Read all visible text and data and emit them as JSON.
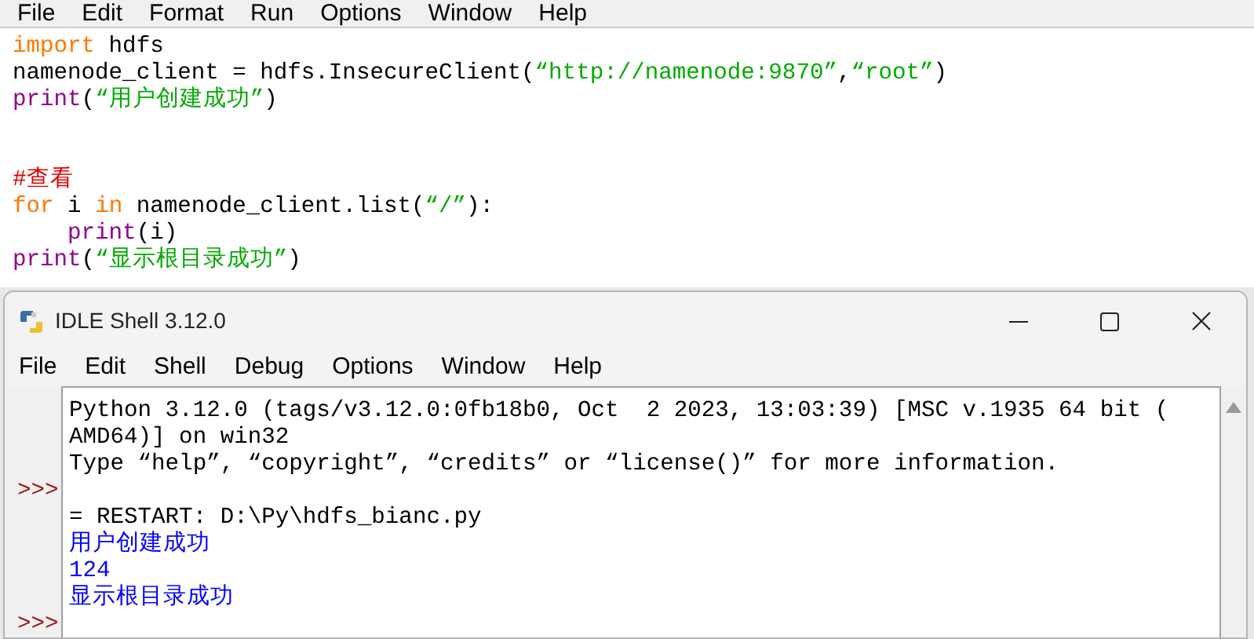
{
  "editor": {
    "menu": [
      "File",
      "Edit",
      "Format",
      "Run",
      "Options",
      "Window",
      "Help"
    ],
    "lines": [
      {
        "kind": "code",
        "indented": false,
        "tokens": [
          {
            "kind": "keyword",
            "text": "import"
          },
          {
            "kind": "plain",
            "text": " hdfs"
          }
        ]
      },
      {
        "kind": "code",
        "indented": false,
        "tokens": [
          {
            "kind": "plain",
            "text": "namenode_client = hdfs.InsecureClient("
          },
          {
            "kind": "string",
            "text": "“http://namenode:9870”"
          },
          {
            "kind": "plain",
            "text": ","
          },
          {
            "kind": "string",
            "text": "“root”"
          },
          {
            "kind": "plain",
            "text": ")"
          }
        ]
      },
      {
        "kind": "code",
        "indented": false,
        "tokens": [
          {
            "kind": "builtin",
            "text": "print"
          },
          {
            "kind": "plain",
            "text": "("
          },
          {
            "kind": "string",
            "text": "“用户创建成功”"
          },
          {
            "kind": "plain",
            "text": ")"
          }
        ]
      },
      {
        "kind": "blank"
      },
      {
        "kind": "blank"
      },
      {
        "kind": "code",
        "indented": false,
        "tokens": [
          {
            "kind": "comment",
            "text": "#查看"
          }
        ]
      },
      {
        "kind": "code",
        "indented": false,
        "tokens": [
          {
            "kind": "keyword",
            "text": "for"
          },
          {
            "kind": "plain",
            "text": " i "
          },
          {
            "kind": "keyword",
            "text": "in"
          },
          {
            "kind": "plain",
            "text": " namenode_client.list("
          },
          {
            "kind": "string",
            "text": "“/”"
          },
          {
            "kind": "plain",
            "text": "):"
          }
        ]
      },
      {
        "kind": "code",
        "indented": true,
        "tokens": [
          {
            "kind": "builtin",
            "text": "print"
          },
          {
            "kind": "plain",
            "text": "(i)"
          }
        ]
      },
      {
        "kind": "code",
        "indented": false,
        "tokens": [
          {
            "kind": "builtin",
            "text": "print"
          },
          {
            "kind": "plain",
            "text": "("
          },
          {
            "kind": "string",
            "text": "“显示根目录成功”"
          },
          {
            "kind": "plain",
            "text": ")"
          }
        ]
      }
    ]
  },
  "shell": {
    "title": "IDLE Shell 3.12.0",
    "menu": [
      "File",
      "Edit",
      "Shell",
      "Debug",
      "Options",
      "Window",
      "Help"
    ],
    "lines": [
      {
        "kind": "plain",
        "text": "Python 3.12.0 (tags/v3.12.0:0fb18b0, Oct  2 2023, 13:03:39) [MSC v.1935 64 bit ("
      },
      {
        "kind": "plain",
        "text": "AMD64)] on win32"
      },
      {
        "kind": "plain",
        "text": "Type “help”, “copyright”, “credits” or “license()” for more information."
      },
      {
        "kind": "plain",
        "prompt": ">>>"
      },
      {
        "kind": "plain",
        "text": "= RESTART: D:\\Py\\hdfs_bianc.py"
      },
      {
        "kind": "stdout",
        "text": "用户创建成功"
      },
      {
        "kind": "stdout",
        "text": "124"
      },
      {
        "kind": "stdout",
        "text": "显示根目录成功"
      },
      {
        "kind": "plain",
        "prompt": ">>>"
      }
    ]
  }
}
